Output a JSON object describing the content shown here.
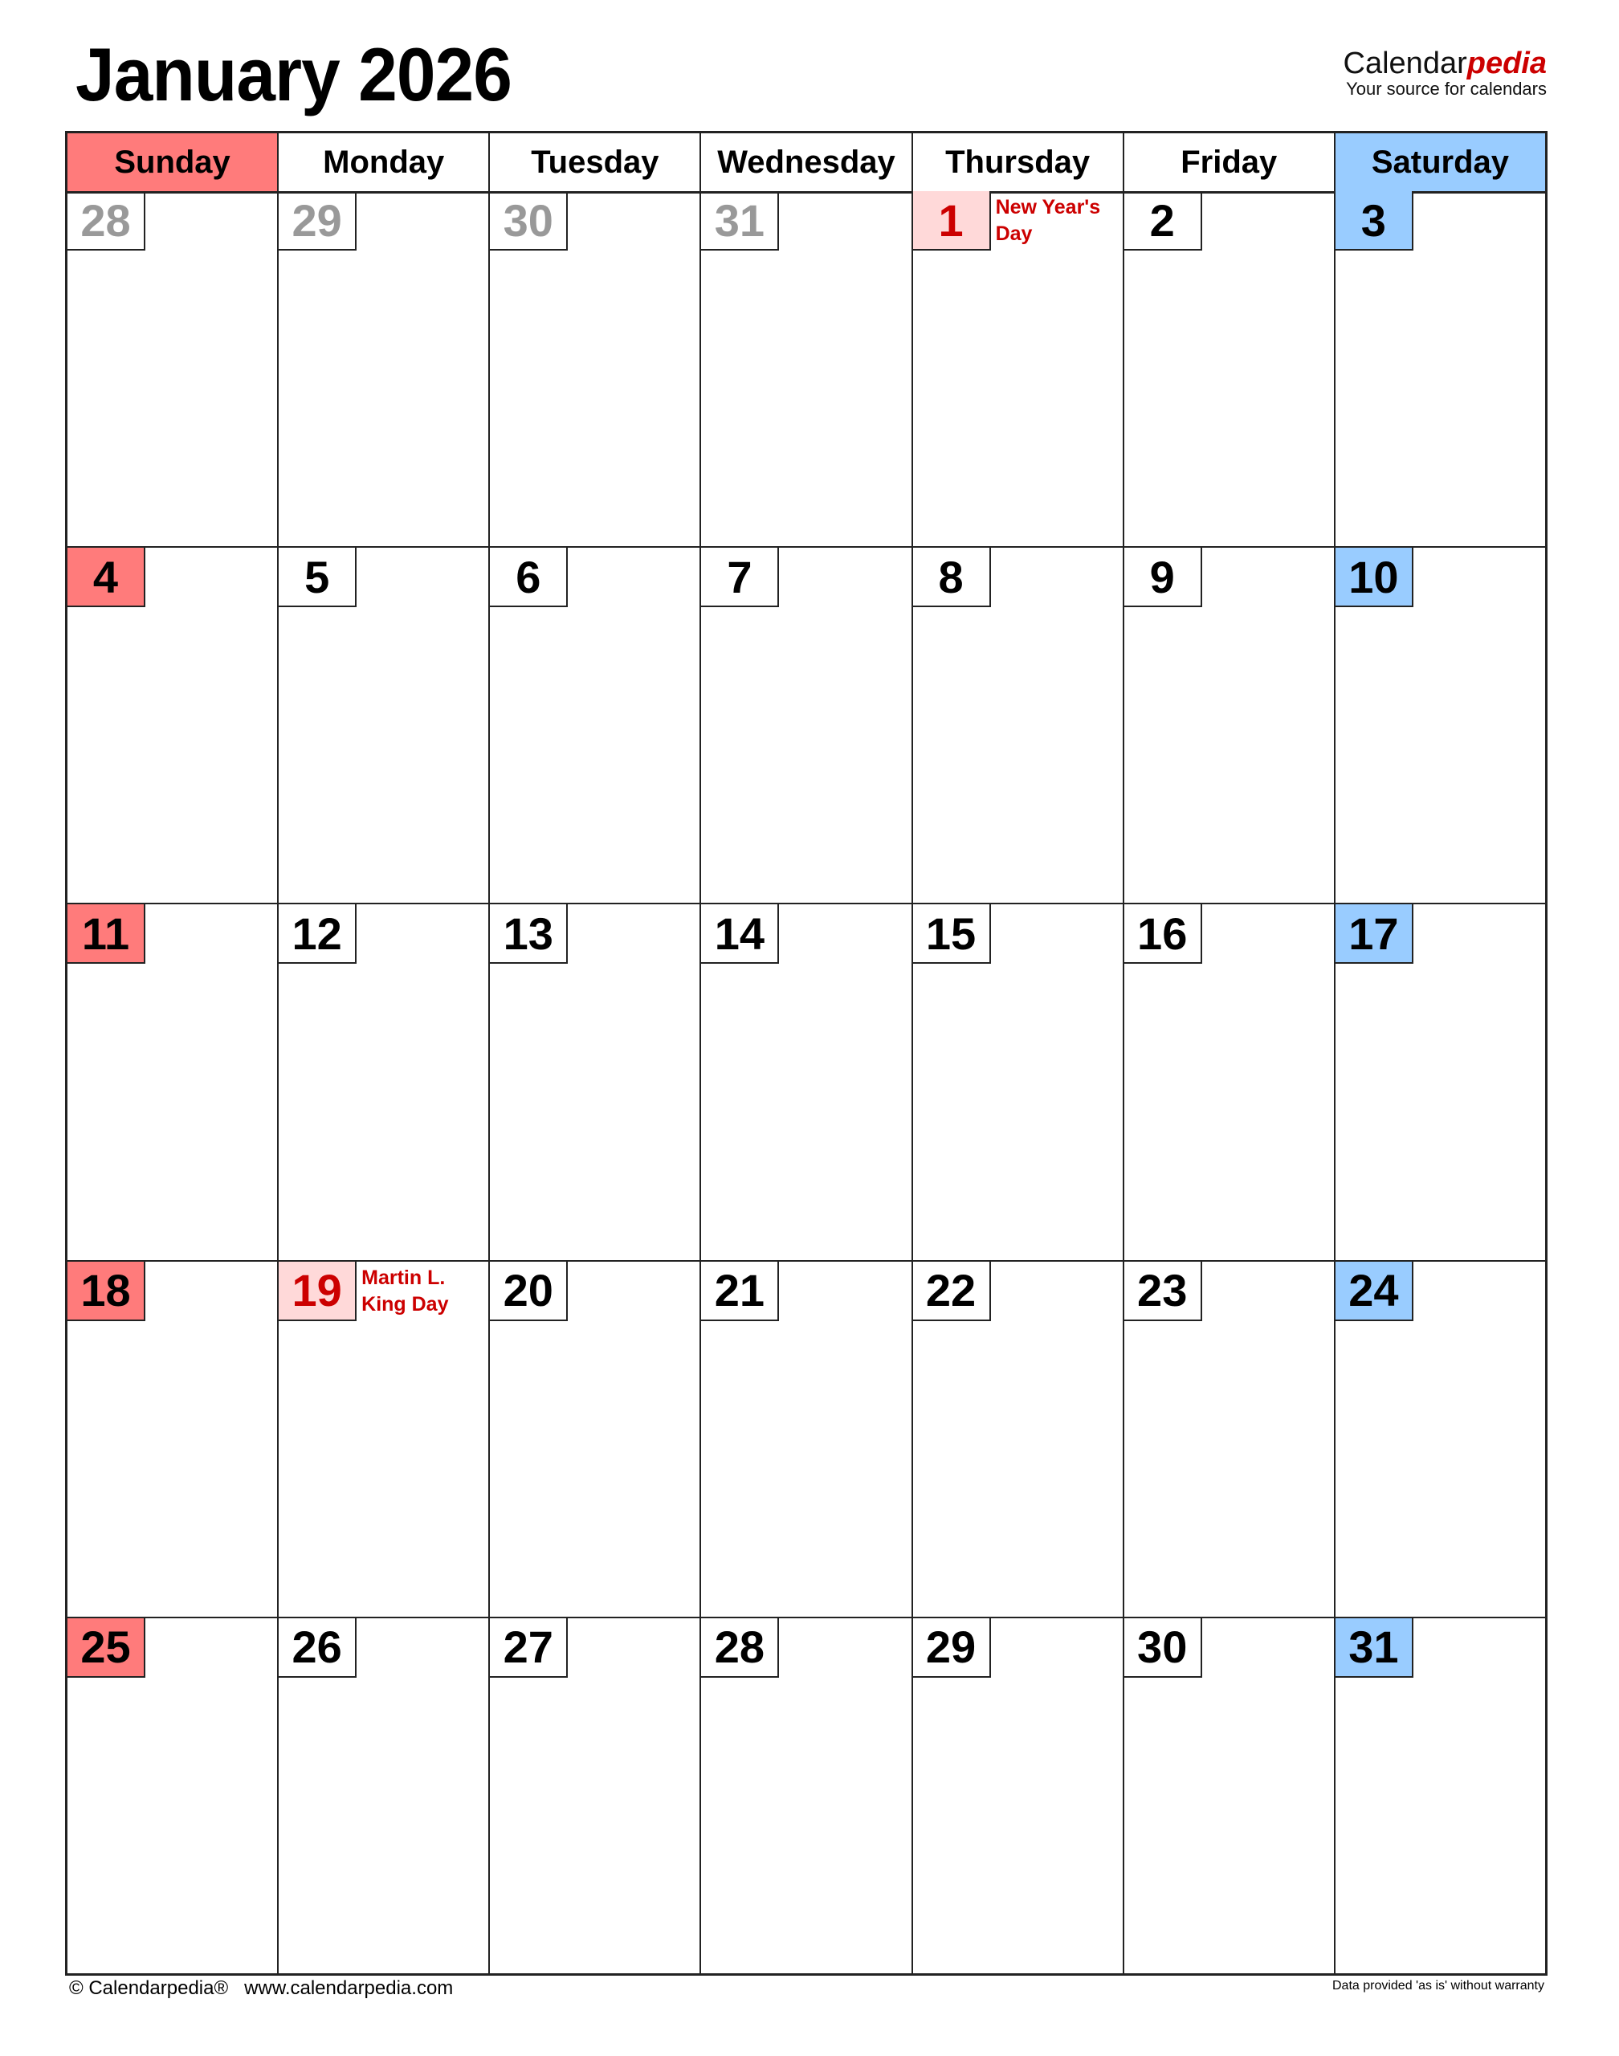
{
  "title": "January 2026",
  "brand": {
    "name_plain": "Calendar",
    "name_accent": "pedia",
    "tagline": "Your source for calendars"
  },
  "colors": {
    "sunday": "#ff7b7b",
    "saturday": "#99ccff",
    "holiday_bg": "#ffd9d9",
    "holiday_text": "#cc0000",
    "other_month": "#999999"
  },
  "weekdays": [
    "Sunday",
    "Monday",
    "Tuesday",
    "Wednesday",
    "Thursday",
    "Friday",
    "Saturday"
  ],
  "weeks": [
    [
      {
        "d": "28",
        "t": "other"
      },
      {
        "d": "29",
        "t": "other"
      },
      {
        "d": "30",
        "t": "other"
      },
      {
        "d": "31",
        "t": "other"
      },
      {
        "d": "1",
        "t": "hol",
        "h": "New Year's Day"
      },
      {
        "d": "2",
        "t": ""
      },
      {
        "d": "3",
        "t": "sat"
      }
    ],
    [
      {
        "d": "4",
        "t": "sun"
      },
      {
        "d": "5",
        "t": ""
      },
      {
        "d": "6",
        "t": ""
      },
      {
        "d": "7",
        "t": ""
      },
      {
        "d": "8",
        "t": ""
      },
      {
        "d": "9",
        "t": ""
      },
      {
        "d": "10",
        "t": "sat"
      }
    ],
    [
      {
        "d": "11",
        "t": "sun"
      },
      {
        "d": "12",
        "t": ""
      },
      {
        "d": "13",
        "t": ""
      },
      {
        "d": "14",
        "t": ""
      },
      {
        "d": "15",
        "t": ""
      },
      {
        "d": "16",
        "t": ""
      },
      {
        "d": "17",
        "t": "sat"
      }
    ],
    [
      {
        "d": "18",
        "t": "sun"
      },
      {
        "d": "19",
        "t": "hol",
        "h": "Martin L. King Day"
      },
      {
        "d": "20",
        "t": ""
      },
      {
        "d": "21",
        "t": ""
      },
      {
        "d": "22",
        "t": ""
      },
      {
        "d": "23",
        "t": ""
      },
      {
        "d": "24",
        "t": "sat"
      }
    ],
    [
      {
        "d": "25",
        "t": "sun"
      },
      {
        "d": "26",
        "t": ""
      },
      {
        "d": "27",
        "t": ""
      },
      {
        "d": "28",
        "t": ""
      },
      {
        "d": "29",
        "t": ""
      },
      {
        "d": "30",
        "t": ""
      },
      {
        "d": "31",
        "t": "sat"
      }
    ]
  ],
  "footer": {
    "copyright": "© Calendarpedia®",
    "url": "www.calendarpedia.com",
    "disclaimer": "Data provided 'as is' without warranty"
  }
}
